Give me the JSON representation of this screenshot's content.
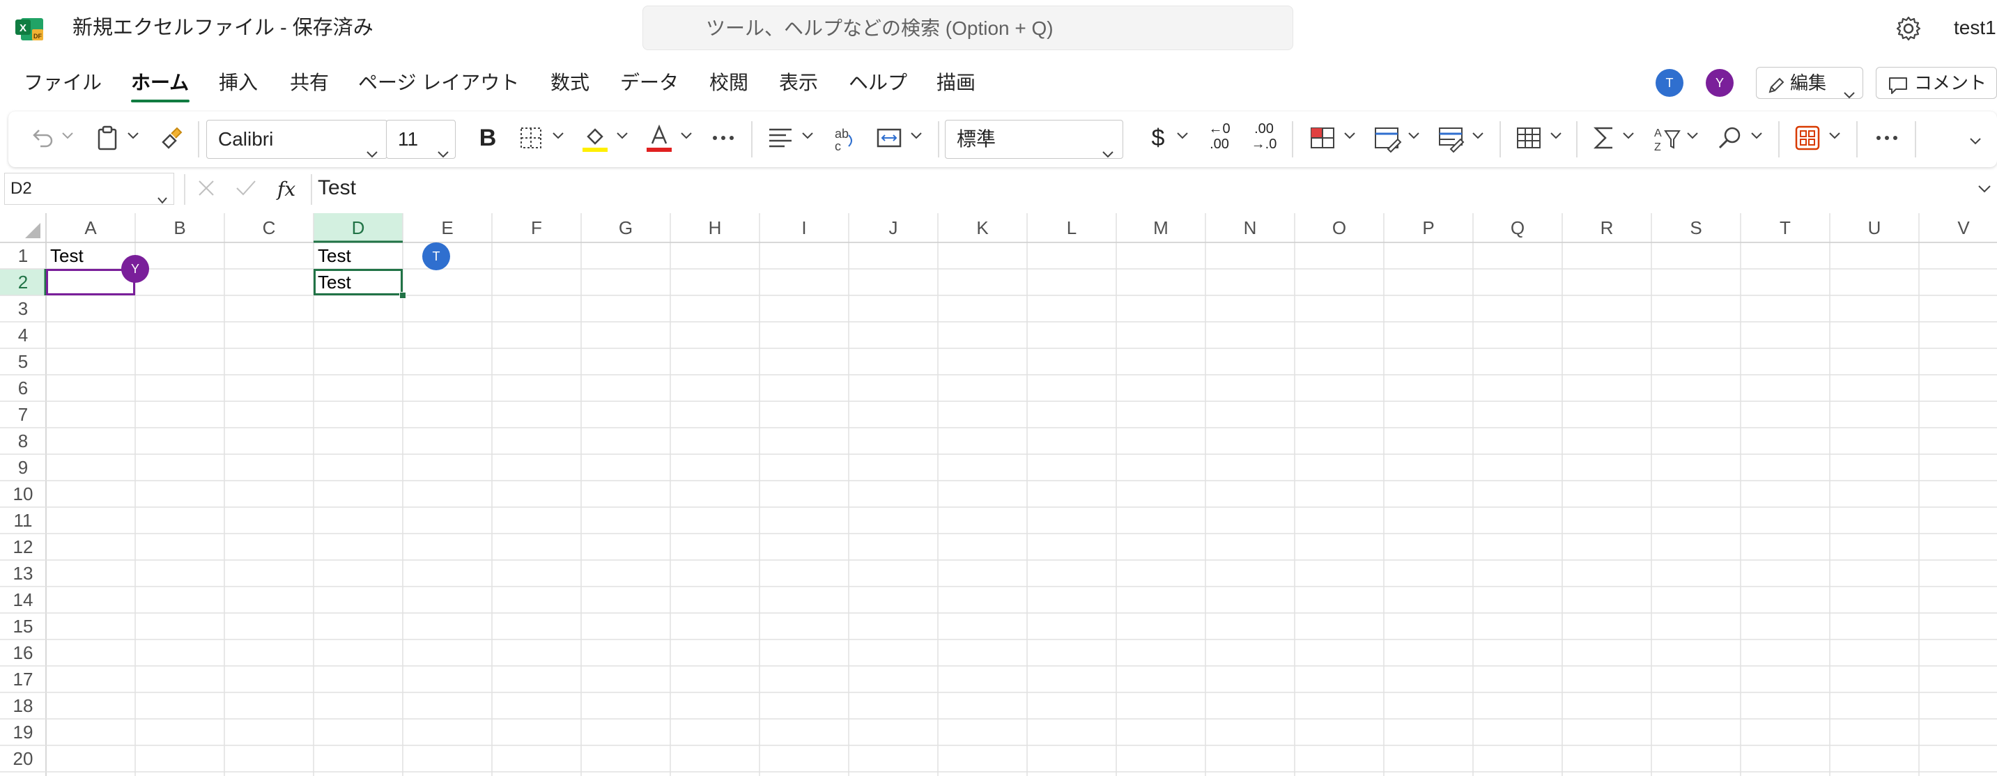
{
  "window": {
    "doc_title": "新規エクセルファイル - 保存済み",
    "search_placeholder": "ツール、ヘルプなどの検索 (Option + Q)",
    "account_name": "test1",
    "app_icon": "excel-icon",
    "settings_icon": "gear-icon"
  },
  "tabs": [
    {
      "label": "ファイル",
      "active": false
    },
    {
      "label": "ホーム",
      "active": true
    },
    {
      "label": "挿入",
      "active": false
    },
    {
      "label": "共有",
      "active": false
    },
    {
      "label": "ページ レイアウト",
      "active": false
    },
    {
      "label": "数式",
      "active": false
    },
    {
      "label": "データ",
      "active": false
    },
    {
      "label": "校閲",
      "active": false
    },
    {
      "label": "表示",
      "active": false
    },
    {
      "label": "ヘルプ",
      "active": false
    },
    {
      "label": "描画",
      "active": false
    }
  ],
  "collaborators": [
    {
      "initial": "T",
      "color": "#2f6fcf"
    },
    {
      "initial": "Y",
      "color": "#7a1f9a"
    }
  ],
  "header_buttons": {
    "edit_label": "編集",
    "comment_label": "コメント"
  },
  "ribbon": {
    "font_name": "Calibri",
    "font_size": "11",
    "bold_label": "B",
    "number_format": "標準",
    "currency_symbol": "$",
    "increase_decimal_top": "←0",
    "increase_decimal_bottom": ".00",
    "decrease_decimal_top": ".00",
    "decrease_decimal_bottom": "→.0",
    "highlight_color": "#ffef00",
    "font_color": "#e02020"
  },
  "formula_bar": {
    "name_box": "D2",
    "fx_label": "fx",
    "content": "Test"
  },
  "sheet": {
    "columns": [
      "A",
      "B",
      "C",
      "D",
      "E",
      "F",
      "G",
      "H",
      "I",
      "J",
      "K",
      "L",
      "M",
      "N",
      "O",
      "P",
      "Q",
      "R",
      "S",
      "T",
      "U",
      "V"
    ],
    "rows": [
      "1",
      "2",
      "3",
      "4",
      "5",
      "6",
      "7",
      "8",
      "9",
      "10",
      "11",
      "12",
      "13",
      "14",
      "15",
      "16",
      "17",
      "18",
      "19",
      "20"
    ],
    "active_cell": "D2",
    "cells": {
      "A1": "Test",
      "D1": "Test",
      "D2": "Test"
    },
    "selection_color": "#217346",
    "remote_selections": [
      {
        "cell": "A2",
        "initial": "Y",
        "color": "#7a1f9a"
      },
      {
        "cell": "E1",
        "initial": "T",
        "color": "#2f6fcf"
      }
    ]
  }
}
